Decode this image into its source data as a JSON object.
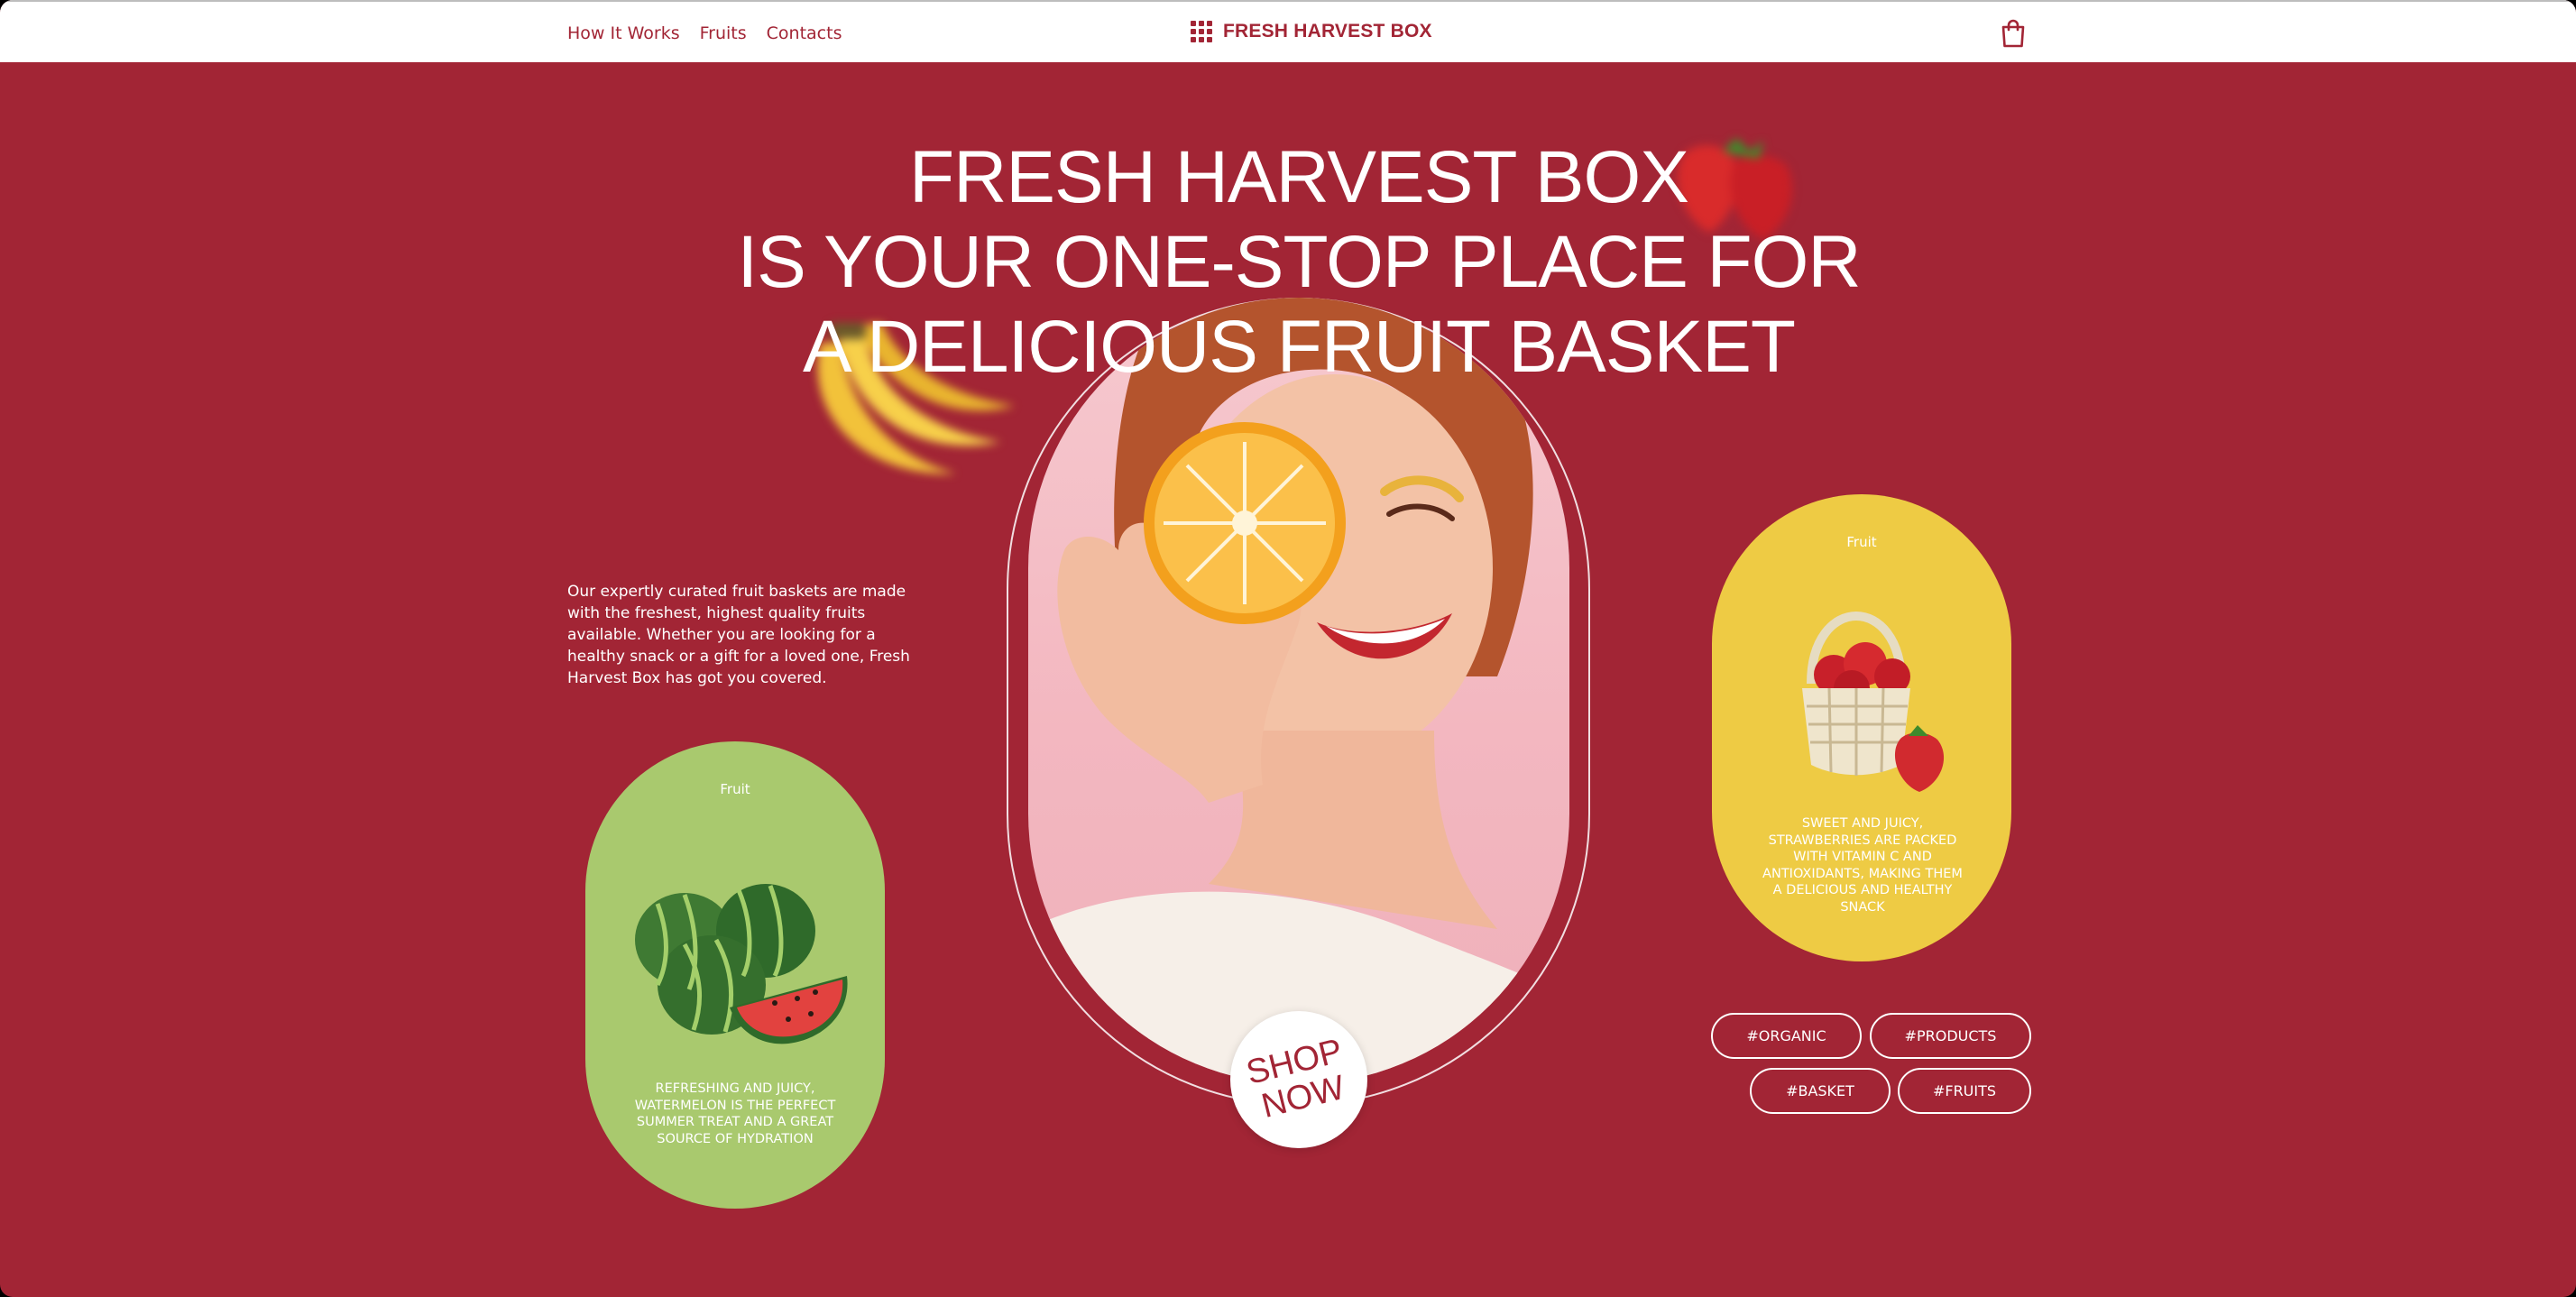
{
  "nav": {
    "links": [
      {
        "label": "How It Works"
      },
      {
        "label": "Fruits"
      },
      {
        "label": "Contacts"
      }
    ],
    "brand": "FRESH HARVEST BOX",
    "cart_icon": "shopping-bag-icon"
  },
  "hero": {
    "title_lines": [
      "FRESH HARVEST BOX",
      "IS YOUR ONE-STOP PLACE FOR",
      "A DELICIOUS FRUIT BASKET"
    ],
    "intro": "Our expertly curated fruit baskets are made with the freshest, highest quality fruits available. Whether you are looking for a healthy snack or a gift for a loved one, Fresh Harvest Box has got you covered.",
    "cta": [
      "SHOP",
      "NOW"
    ]
  },
  "cards": [
    {
      "label": "Fruit",
      "description": "REFRESHING AND JUICY, WATERMELON IS THE PERFECT SUMMER TREAT AND A GREAT SOURCE OF HYDRATION",
      "color": "#a9c96e",
      "image": "watermelon"
    },
    {
      "label": "Fruit",
      "description": "SWEET AND JUICY, STRAWBERRIES ARE PACKED WITH VITAMIN C AND ANTIOXIDANTS, MAKING THEM A DELICIOUS AND HEALTHY SNACK",
      "color": "#eecb44",
      "image": "strawberry-basket"
    }
  ],
  "tags": [
    "#ORGANIC",
    "#PRODUCTS",
    "#BASKET",
    "#FRUITS"
  ],
  "colors": {
    "brand": "#a22535",
    "background": "#a22535",
    "green_card": "#a9c96e",
    "yellow_card": "#eecb44",
    "nav_background": "#ffffff"
  }
}
